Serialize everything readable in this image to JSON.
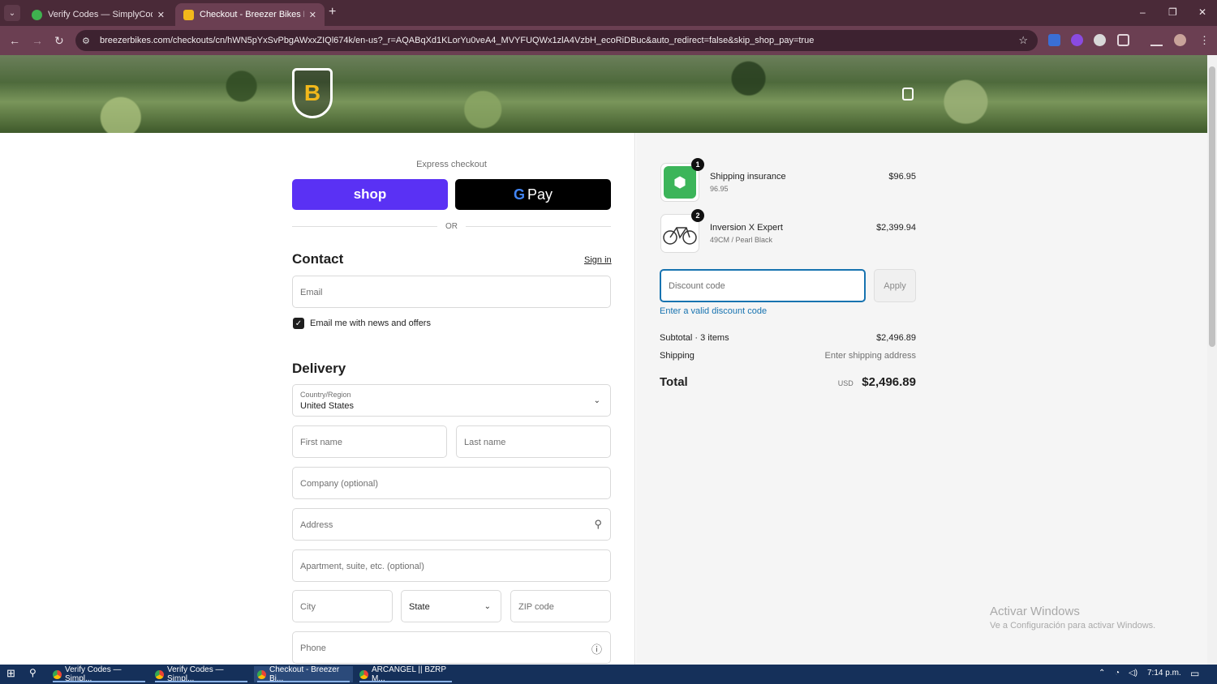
{
  "browser": {
    "tabs": [
      {
        "title": "Verify Codes — SimplyCodes",
        "active": false
      },
      {
        "title": "Checkout - Breezer Bikes Powered",
        "active": true
      }
    ],
    "new_tab": "+",
    "close": "✕",
    "url": "breezerbikes.com/checkouts/cn/hWN5pYxSvPbgAWxxZIQl674k/en-us?_r=AQABqXd1KLorYu0veA4_MVYFUQWx1zlA4VzbH_ecoRiDBuc&auto_redirect=false&skip_shop_pay=true",
    "window": {
      "minimize": "–",
      "restore": "❐",
      "close": "✕"
    }
  },
  "header": {
    "logo_letter": "B"
  },
  "checkout": {
    "express_label": "Express checkout",
    "shop_label": "shop",
    "gpay_g": "G",
    "gpay_label": "Pay",
    "or_label": "OR",
    "contact": {
      "heading": "Contact",
      "sign_in": "Sign in",
      "email_placeholder": "Email",
      "newsletter_label": "Email me with news and offers",
      "newsletter_checked": true
    },
    "delivery": {
      "heading": "Delivery",
      "country_label": "Country/Region",
      "country_value": "United States",
      "first_name": "First name",
      "last_name": "Last name",
      "company": "Company (optional)",
      "address": "Address",
      "apartment": "Apartment, suite, etc. (optional)",
      "city": "City",
      "state": "State",
      "zip": "ZIP code",
      "phone": "Phone"
    }
  },
  "summary": {
    "items": [
      {
        "name": "Shipping insurance",
        "sub": "96.95",
        "price": "$96.95",
        "qty": "1"
      },
      {
        "name": "Inversion X Expert",
        "sub": "49CM / Pearl Black",
        "price": "$2,399.94",
        "qty": "2"
      }
    ],
    "discount_placeholder": "Discount code",
    "apply_label": "Apply",
    "discount_error": "Enter a valid discount code",
    "subtotal_label": "Subtotal · 3 items",
    "subtotal_value": "$2,496.89",
    "shipping_label": "Shipping",
    "shipping_value": "Enter shipping address",
    "total_label": "Total",
    "total_currency": "USD",
    "total_value": "$2,496.89"
  },
  "watermark": {
    "line1": "Activar Windows",
    "line2": "Ve a Configuración para activar Windows."
  },
  "taskbar": {
    "items": [
      {
        "title": "Verify Codes — Simpl..."
      },
      {
        "title": "Verify Codes — Simpl..."
      },
      {
        "title": "Checkout - Breezer Bi..."
      },
      {
        "title": "ARCANGEL || BZRP M..."
      }
    ],
    "time": "7:14 p.m."
  },
  "colors": {
    "shop_purple": "#5a31f4",
    "link_blue": "#1773b0",
    "browser_frame": "#6b3f52"
  }
}
